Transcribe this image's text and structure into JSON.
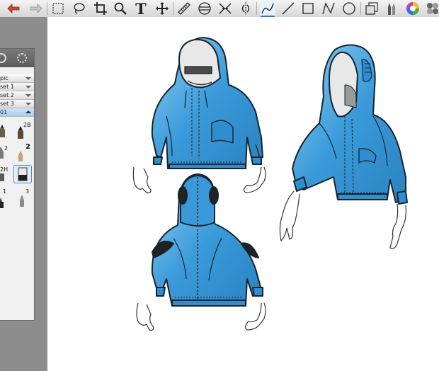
{
  "toolbar": {
    "tools": [
      "undo-icon",
      "redo-icon",
      "rect-select-icon",
      "lasso-icon",
      "crop-icon",
      "zoom-icon",
      "text-icon",
      "move-icon",
      "ruler-icon",
      "ellipse-guide-icon",
      "symmetry-icon",
      "perspective-icon",
      "line-icon",
      "straight-line-icon",
      "rectangle-icon",
      "polyline-icon",
      "ellipse-icon",
      "layers-icon",
      "brush-library-icon",
      "color-wheel-icon",
      "swatches-icon"
    ],
    "text_tool_glyph": "T",
    "accent_color": "#2a7bd6"
  },
  "palette": {
    "presets": [
      {
        "label": "pic",
        "selected": false
      },
      {
        "label": "set 1",
        "selected": false
      },
      {
        "label": "set 2",
        "selected": false
      },
      {
        "label": "set 3",
        "selected": false
      },
      {
        "label": "01",
        "selected": true
      }
    ],
    "brushes": {
      "b1": "2B",
      "b2": "2",
      "b3": "2",
      "b4": "2H",
      "b5": "1",
      "b6": "3"
    }
  },
  "canvas": {
    "hoodie_color": "#3a9ad9",
    "hoodie_highlight": "#8fd0f5",
    "outline_color": "#16242e"
  }
}
